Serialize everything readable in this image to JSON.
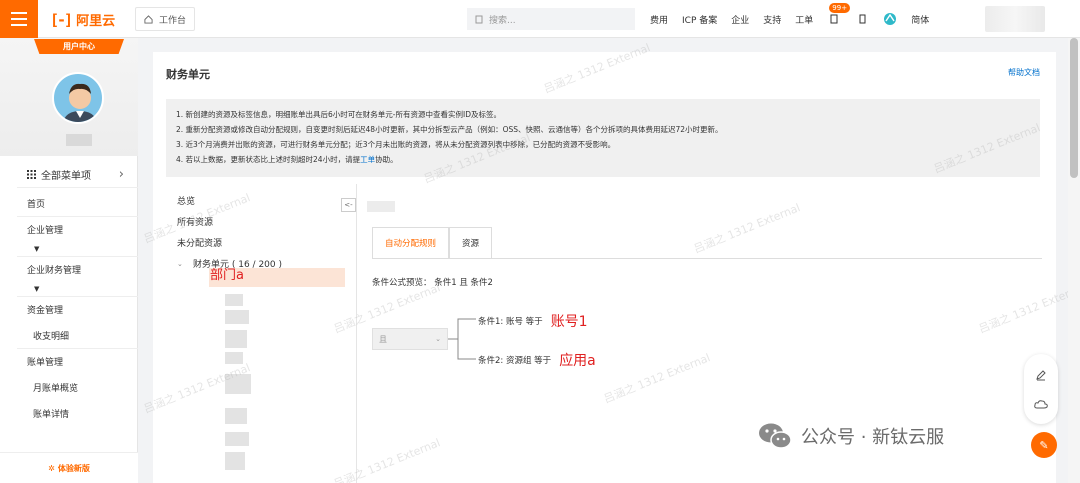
{
  "topbar": {
    "logo_text": "阿里云",
    "workbench": "工作台",
    "search_placeholder": "搜索...",
    "nav": [
      "费用",
      "ICP 备案",
      "企业",
      "支持",
      "工单"
    ],
    "badge": "99+",
    "lang": "简体"
  },
  "sidebar": {
    "user_center": "用户中心",
    "all_menu": "全部菜单项",
    "items": [
      {
        "label": "首页",
        "kind": "item"
      },
      {
        "label": "企业管理",
        "kind": "group"
      },
      {
        "label": "企业财务管理",
        "kind": "group"
      },
      {
        "label": "资金管理",
        "kind": "item"
      },
      {
        "label": "收支明细",
        "kind": "sub"
      },
      {
        "label": "账单管理",
        "kind": "item"
      },
      {
        "label": "月账单概览",
        "kind": "sub"
      },
      {
        "label": "账单详情",
        "kind": "sub"
      }
    ],
    "try_new": "体验新版"
  },
  "main": {
    "title": "财务单元",
    "help": "帮助文档",
    "notice": [
      "1. 新创建的资源及标签信息，明细账单出具后6小时可在财务单元-所有资源中查看实例ID及标签。",
      "2. 重新分配资源或修改自动分配规则，自变更时刻后延迟48小时更新，其中分拆型云产品（例如：OSS、快照、云通信等）各个分拆项的具体费用延迟72小时更新。",
      "3. 近3个月消费并出账的资源，可进行财务单元分配；近3个月未出账的资源，将从未分配资源列表中移除，已分配的资源不受影响。",
      "4. 若以上数据，更新状态比上述时刻超时24小时，请提"
    ],
    "notice_link": "工单",
    "notice_tail": "协助。",
    "tree": [
      "总览",
      "所有资源",
      "未分配资源"
    ],
    "unit": "财务单元 ( 16 / 200 )",
    "dept": "部门a",
    "collapse": "<-",
    "tabs": [
      "自动分配规则",
      "资源"
    ],
    "formula": "条件公式预览：  条件1 且 条件2",
    "and_select": "且",
    "cond1": {
      "prefix": "条件1:  账号   等于",
      "value": "账号1"
    },
    "cond2": {
      "prefix": "条件2:  资源组   等于",
      "value": "应用a"
    }
  },
  "watermark": "吕涵之 1312 External",
  "brand_watermark": "公众号 · 新钛云服"
}
